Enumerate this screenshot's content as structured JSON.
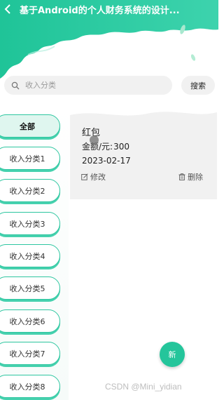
{
  "header": {
    "title": "基于Android的个人财务系统的设计...",
    "accent_color": "#27c9a0",
    "back_icon": "chevron-left-icon"
  },
  "search": {
    "placeholder": "收入分类",
    "button_label": "搜索",
    "icon": "search-icon"
  },
  "categories": [
    {
      "label": "全部",
      "active": true
    },
    {
      "label": "收入分类1"
    },
    {
      "label": "收入分类2"
    },
    {
      "label": "收入分类3"
    },
    {
      "label": "收入分类4"
    },
    {
      "label": "收入分类5"
    },
    {
      "label": "收入分类6"
    },
    {
      "label": "收入分类7"
    },
    {
      "label": "收入分类8"
    }
  ],
  "record": {
    "name": "红包",
    "amount_label": "金额/元:",
    "amount_value": "300",
    "date": "2023-02-17",
    "edit_label": "修改",
    "delete_label": "删除"
  },
  "fab": {
    "label": "新"
  },
  "watermark": "CSDN @Mini_yidian"
}
